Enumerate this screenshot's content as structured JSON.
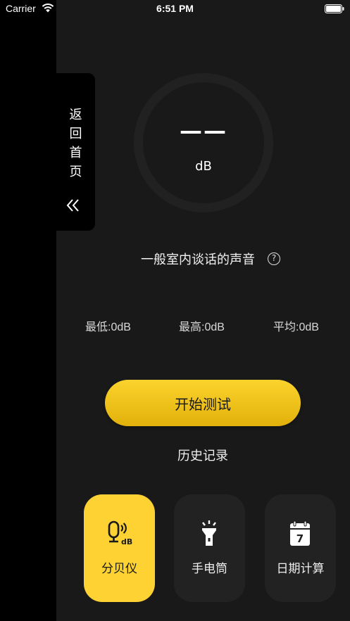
{
  "status_bar": {
    "carrier": "Carrier",
    "time": "6:51 PM"
  },
  "side_tab": {
    "chars": [
      "返",
      "回",
      "首",
      "页"
    ],
    "icon": "chevron-double-left-icon"
  },
  "meter": {
    "value": "——",
    "unit": "dB"
  },
  "description": {
    "text": "一般室内谈话的声音",
    "help_symbol": "?"
  },
  "stats": {
    "min": "最低:0dB",
    "max": "最高:0dB",
    "avg": "平均:0dB"
  },
  "actions": {
    "start_label": "开始测试",
    "history_label": "历史记录"
  },
  "tools": [
    {
      "label": "分贝仪",
      "icon": "decibel-meter-icon",
      "active": true
    },
    {
      "label": "手电筒",
      "icon": "flashlight-icon",
      "active": false
    },
    {
      "label": "日期计算",
      "icon": "calendar-icon",
      "active": false
    }
  ],
  "colors": {
    "accent": "#fdd232",
    "background": "#191919",
    "card": "#222222"
  }
}
